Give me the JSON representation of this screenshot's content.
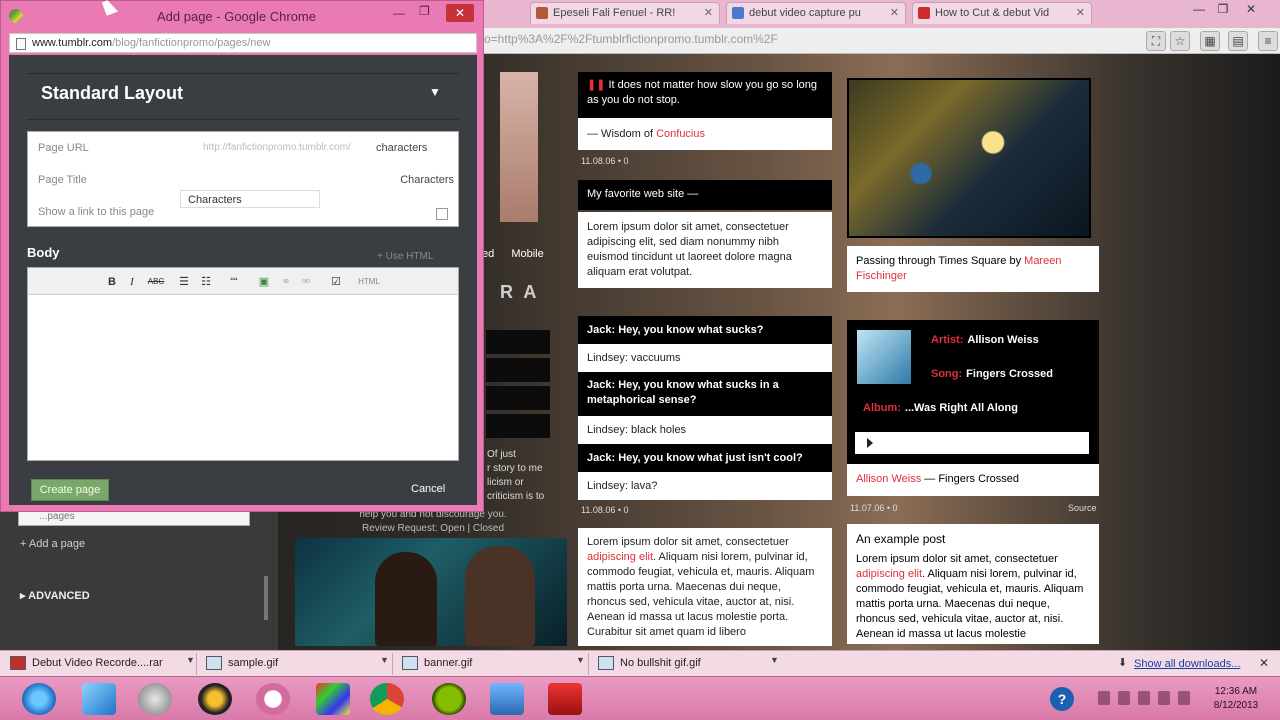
{
  "background_browser": {
    "tabs": [
      {
        "label": "Epeseli Fali Fenuel - RR!"
      },
      {
        "label": "debut video capture pu"
      },
      {
        "label": "How to Cut & debut Vid"
      }
    ],
    "url": "o=http%3A%2F%2Ftumblrfictionpromo.tumblr.com%2F"
  },
  "popup": {
    "window_title": "Add page - Google Chrome",
    "url_host": "www.tumblr.com",
    "url_path": "/blog/fanfictionpromo/pages/new",
    "layout_title": "Standard Layout",
    "form": {
      "page_url_label": "Page URL",
      "page_url_prefix": "http://fanfictionpromo.tumblr.com/",
      "page_url_value": "characters",
      "page_title_label": "Page Title",
      "page_title_value": "Characters",
      "autocomplete_suggestion": "Characters",
      "show_link_label": "Show a link to this page"
    },
    "body_label": "Body",
    "html_toggle": "+ Use HTML",
    "toolbar": {
      "bold": "B",
      "italic": "I",
      "strike": "ABC",
      "quote": "““",
      "html": "HTML"
    },
    "create_button": "Create page",
    "cancel_button": "Cancel"
  },
  "left_panel": {
    "input_value": "...pages",
    "add_page": "+ Add a page",
    "advanced": "ADVANCED"
  },
  "middle_strip": {
    "mobile": "Mobile",
    "partial_a": "ed",
    "big_text": "R A",
    "story_text": "Of just\nr story to me\nlicism or\ncriticism is to",
    "review_text": "help you and not discourage you.\nReview Request: Open | Closed"
  },
  "posts_middle": {
    "quote": "It does not matter how slow you go so long as you do not stop.",
    "quote_source_prefix": "— Wisdom of ",
    "quote_source_link": "Confucius",
    "quote_meta": "11.08.06 • 0",
    "link_post": "My favorite web site —",
    "link_body": "Lorem ipsum dolor sit amet, consectetuer adipiscing elit, sed diam nonummy nibh euismod tincidunt ut laoreet dolore magna aliquam erat volutpat.",
    "chat": [
      {
        "text": "Jack: Hey, you know what sucks?",
        "style": "dark"
      },
      {
        "text": "Lindsey: vaccuums",
        "style": "light"
      },
      {
        "text": "Jack: Hey, you know what sucks in a metaphorical sense?",
        "style": "dark"
      },
      {
        "text": "Lindsey: black holes",
        "style": "light"
      },
      {
        "text": "Jack: Hey, you know what just isn't cool?",
        "style": "dark"
      },
      {
        "text": "Lindsey: lava?",
        "style": "light"
      }
    ],
    "chat_meta": "11.08.06 • 0",
    "text_post_start": "Lorem ipsum dolor sit amet, consectetuer ",
    "text_post_link": "adipiscing elit",
    "text_post_rest": ". Aliquam nisi lorem, pulvinar id, commodo feugiat, vehicula et, mauris. Aliquam mattis porta urna. Maecenas dui neque, rhoncus sed, vehicula vitae, auctor at, nisi. Aenean id massa ut lacus molestie porta. Curabitur sit amet quam id libero"
  },
  "posts_right": {
    "photo_caption_prefix": "Passing through Times Square by ",
    "photo_caption_link": "Mareen Fischinger",
    "audio": {
      "artist_key": "Artist:",
      "artist": "Allison Weiss",
      "song_key": "Song:",
      "song": "Fingers Crossed",
      "album_key": "Album:",
      "album": "...Was Right All Along"
    },
    "audio_caption_link": "Allison Weiss",
    "audio_caption_rest": " — Fingers Crossed",
    "audio_meta": "11.07.06 • 0",
    "audio_source": "Source",
    "example_title": "An example post",
    "example_start": "Lorem ipsum dolor sit amet, consectetuer ",
    "example_link": "adipiscing elit",
    "example_rest": ". Aliquam nisi lorem, pulvinar id, commodo feugiat, vehicula et, mauris. Aliquam mattis porta urna. Maecenas dui neque, rhoncus sed, vehicula vitae, auctor at, nisi. Aenean id massa ut lacus molestie"
  },
  "downloads": {
    "items": [
      {
        "name": "Debut Video Recorde....rar"
      },
      {
        "name": "sample.gif"
      },
      {
        "name": "banner.gif"
      },
      {
        "name": "No bullshit gif.gif"
      }
    ],
    "show_all": "Show all downloads...",
    "close": "✕"
  },
  "taskbar": {
    "clock_time": "12:36 AM",
    "clock_date": "8/12/2013",
    "apps": [
      "ie-icon",
      "pen-icon",
      "globe-icon",
      "media-icon",
      "hp-icon",
      "photo-app-icon",
      "chrome-icon",
      "spotify-icon",
      "monitor-icon",
      "recorder-icon"
    ]
  }
}
